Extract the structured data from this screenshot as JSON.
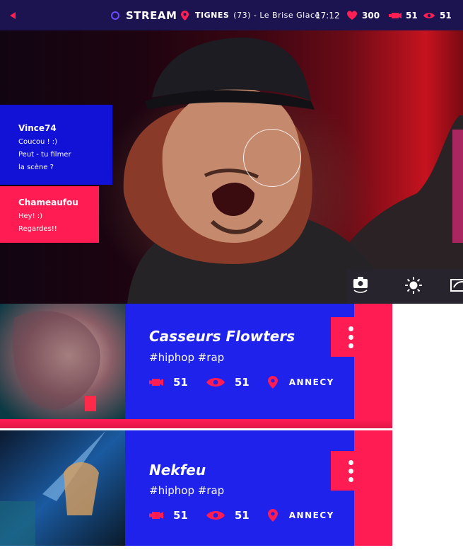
{
  "topbar": {
    "back_icon": "back-arrow-icon",
    "stream_label": "STREAM",
    "location_name": "TIGNES",
    "location_detail": "(73) - Le Brise Glace",
    "time": "17:12",
    "stats": {
      "likes": "300",
      "cameras": "51",
      "views": "51"
    }
  },
  "hero": {
    "chat": [
      {
        "user": "Vince74",
        "lines": [
          "Coucou ! :)",
          "Peut - tu filmer",
          "la scène ?"
        ]
      },
      {
        "user": "Chameaufou",
        "lines": [
          "Hey! :)",
          "Regardes!!"
        ]
      }
    ],
    "tools": [
      "switch-camera-icon",
      "brightness-icon",
      "share-icon"
    ]
  },
  "streams": [
    {
      "title": "Casseurs Flowters",
      "tags": "#hiphop #rap",
      "cameras": "51",
      "views": "51",
      "city": "ANNECY"
    },
    {
      "title": "Nekfeu",
      "tags": "#hiphop #rap",
      "cameras": "51",
      "views": "51",
      "city": "ANNECY"
    }
  ],
  "colors": {
    "accent": "#ff1c53",
    "blue": "#1e22ea",
    "navy": "#1b1450"
  }
}
